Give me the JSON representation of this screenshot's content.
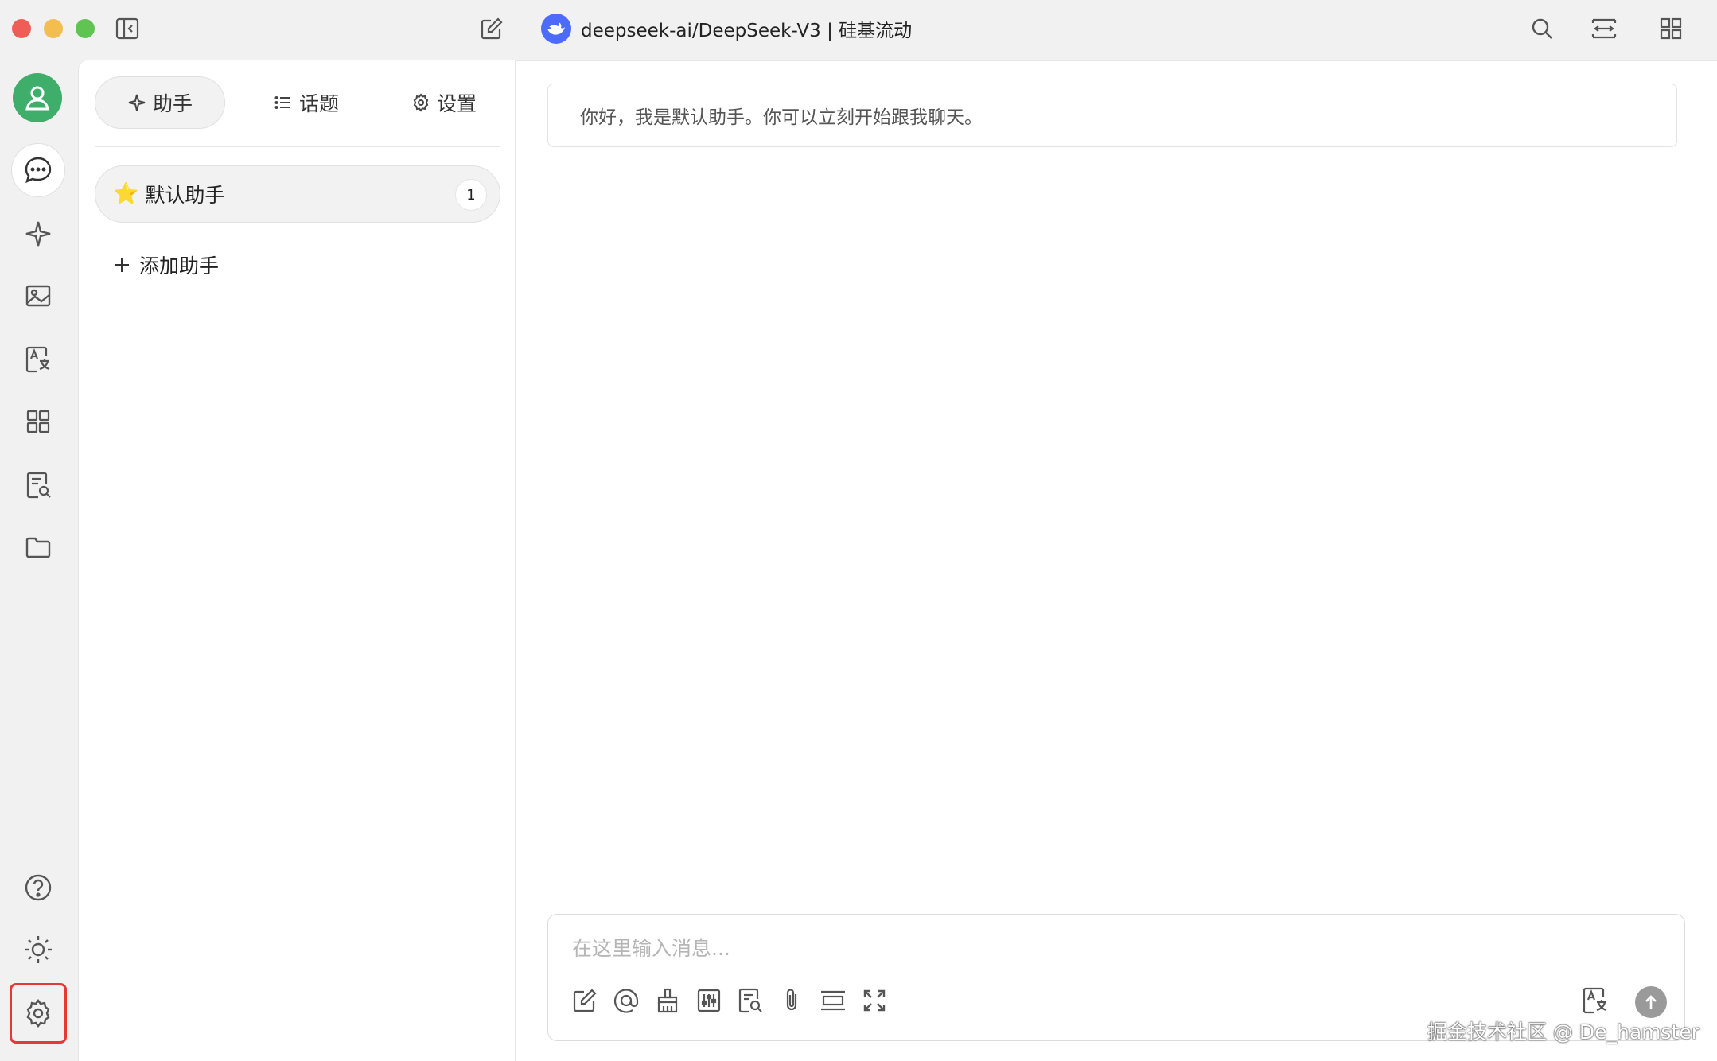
{
  "titlebar": {
    "model_title": "deepseek-ai/DeepSeek-V3 | 硅基流动"
  },
  "sidebar_rail": {
    "items": [
      {
        "icon": "chat-icon",
        "active": true
      },
      {
        "icon": "sparkle-icon"
      },
      {
        "icon": "image-icon"
      },
      {
        "icon": "translate-icon"
      },
      {
        "icon": "apps-grid-icon"
      },
      {
        "icon": "knowledge-search-icon"
      },
      {
        "icon": "folder-icon"
      }
    ],
    "bottom_items": [
      {
        "icon": "help-icon"
      },
      {
        "icon": "theme-sun-icon"
      },
      {
        "icon": "settings-gear-icon",
        "highlighted": true,
        "highlight_color": "#e53935"
      }
    ]
  },
  "panel": {
    "tabs": [
      {
        "label": "助手",
        "icon": "sparkle-icon",
        "active": true
      },
      {
        "label": "话题",
        "icon": "list-icon"
      },
      {
        "label": "设置",
        "icon": "gear-icon"
      }
    ],
    "assistant": {
      "name": "默认助手",
      "emoji": "⭐",
      "count": "1"
    },
    "add_assistant_label": "添加助手"
  },
  "chat": {
    "greeting": "你好，我是默认助手。你可以立刻开始跟我聊天。",
    "input_placeholder": "在这里输入消息...",
    "toolbar_icons": [
      "new-topic-icon",
      "mention-icon",
      "clear-broom-icon",
      "settings-sliders-icon",
      "knowledge-icon",
      "attachment-clip-icon",
      "context-break-icon",
      "fullscreen-expand-icon",
      "translate-icon",
      "send-arrow-icon"
    ]
  },
  "watermark": "掘金技术社区 @ De_hamster",
  "colors": {
    "avatar_bg": "#3fae6a",
    "model_logo_bg": "#4d6bfe",
    "highlight_border": "#e53935",
    "send_button": "#9a9a9a"
  }
}
